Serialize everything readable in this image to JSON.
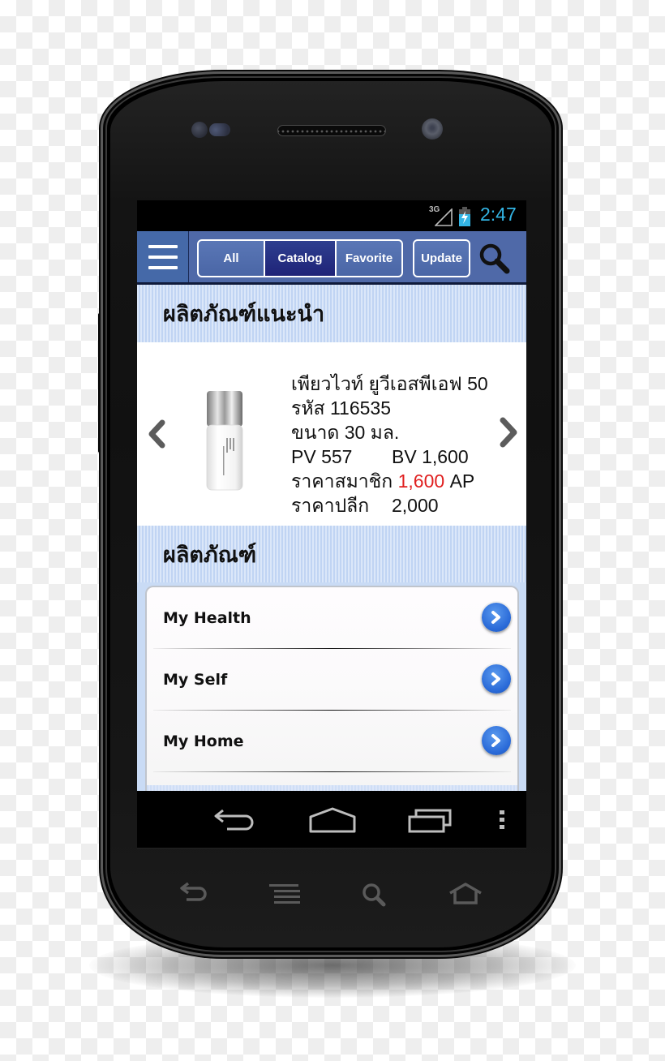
{
  "device": {
    "hardware_buttons": [
      {
        "icon": "back-icon"
      },
      {
        "icon": "menu-icon"
      },
      {
        "icon": "search-icon"
      },
      {
        "icon": "home-icon"
      }
    ]
  },
  "status_bar": {
    "network": "3G",
    "signal_icon": "signal-icon",
    "battery_icon": "battery-charging-icon",
    "clock": "2:47"
  },
  "header": {
    "menu_icon": "hamburger-menu-icon",
    "tabs": [
      {
        "label": "All",
        "selected": false
      },
      {
        "label": "Catalog",
        "selected": true
      },
      {
        "label": "Favorite",
        "selected": false
      }
    ],
    "update_label": "Update",
    "search_icon": "search-icon"
  },
  "featured": {
    "title": "ผลิตภัณฑ์แนะนำ",
    "product": {
      "name": "เพียวไวท์ ยูวีเอสพีเอฟ 50",
      "code_label": "รหัส",
      "code": "116535",
      "size_label": "ขนาด",
      "size": "30 มล.",
      "pv_label": "PV",
      "pv": "557",
      "bv_label": "BV",
      "bv": "1,600",
      "member_price_label": "ราคาสมาชิก",
      "member_price": "1,600",
      "member_price_unit": "AP",
      "retail_price_label": "ราคาปลีก",
      "retail_price": "2,000"
    },
    "prev_icon": "chevron-left-icon",
    "next_icon": "chevron-right-icon"
  },
  "products": {
    "title": "ผลิตภัณฑ์",
    "items": [
      {
        "label": "My Health"
      },
      {
        "label": "My Self"
      },
      {
        "label": "My Home"
      }
    ]
  },
  "nav_bar": {
    "buttons": [
      {
        "icon": "back-icon"
      },
      {
        "icon": "home-icon"
      },
      {
        "icon": "recent-apps-icon"
      },
      {
        "icon": "overflow-menu-icon"
      }
    ]
  },
  "colors": {
    "header_bg": "#4f69a8",
    "selected_tab": "#1f2378",
    "clock": "#33b5e5",
    "price_highlight": "#e02020",
    "list_chevron": "#2a6ad8"
  }
}
